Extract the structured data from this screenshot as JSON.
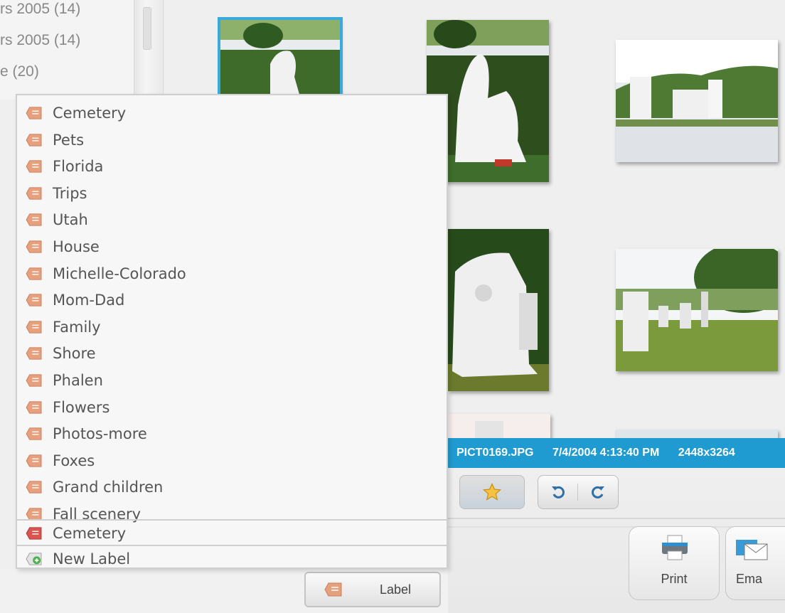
{
  "folders": [
    {
      "label": "rs 2005 (14)"
    },
    {
      "label": "rs 2005 (14)"
    },
    {
      "label": "e (20)"
    }
  ],
  "label_menu": {
    "items": [
      {
        "label": "Cemetery",
        "icon": "label-tag-icon"
      },
      {
        "label": "Pets",
        "icon": "label-tag-icon"
      },
      {
        "label": "Florida",
        "icon": "label-tag-icon"
      },
      {
        "label": "Trips",
        "icon": "label-tag-icon"
      },
      {
        "label": "Utah",
        "icon": "label-tag-icon"
      },
      {
        "label": "House",
        "icon": "label-tag-icon"
      },
      {
        "label": "Michelle-Colorado",
        "icon": "label-tag-icon"
      },
      {
        "label": "Mom-Dad",
        "icon": "label-tag-icon"
      },
      {
        "label": "Family",
        "icon": "label-tag-icon"
      },
      {
        "label": "Shore",
        "icon": "label-tag-icon"
      },
      {
        "label": "Phalen",
        "icon": "label-tag-icon"
      },
      {
        "label": "Flowers",
        "icon": "label-tag-icon"
      },
      {
        "label": "Photos-more",
        "icon": "label-tag-icon"
      },
      {
        "label": "Foxes",
        "icon": "label-tag-icon"
      },
      {
        "label": "Grand children",
        "icon": "label-tag-icon"
      },
      {
        "label": "Fall scenery",
        "icon": "label-tag-icon"
      }
    ],
    "applied_label": "Cemetery",
    "new_label": "New Label"
  },
  "label_button": {
    "label": "Label"
  },
  "info_bar": {
    "filename": "PICT0169.JPG",
    "datetime": "7/4/2004 4:13:40 PM",
    "dimensions": "2448x3264"
  },
  "toolbar": {
    "print_label": "Print",
    "email_label": "Ema"
  },
  "colors": {
    "accent": "#1f9bd1",
    "tag_orange": "#e7a07e",
    "tag_red": "#d9534f",
    "star": "#f5c242"
  }
}
